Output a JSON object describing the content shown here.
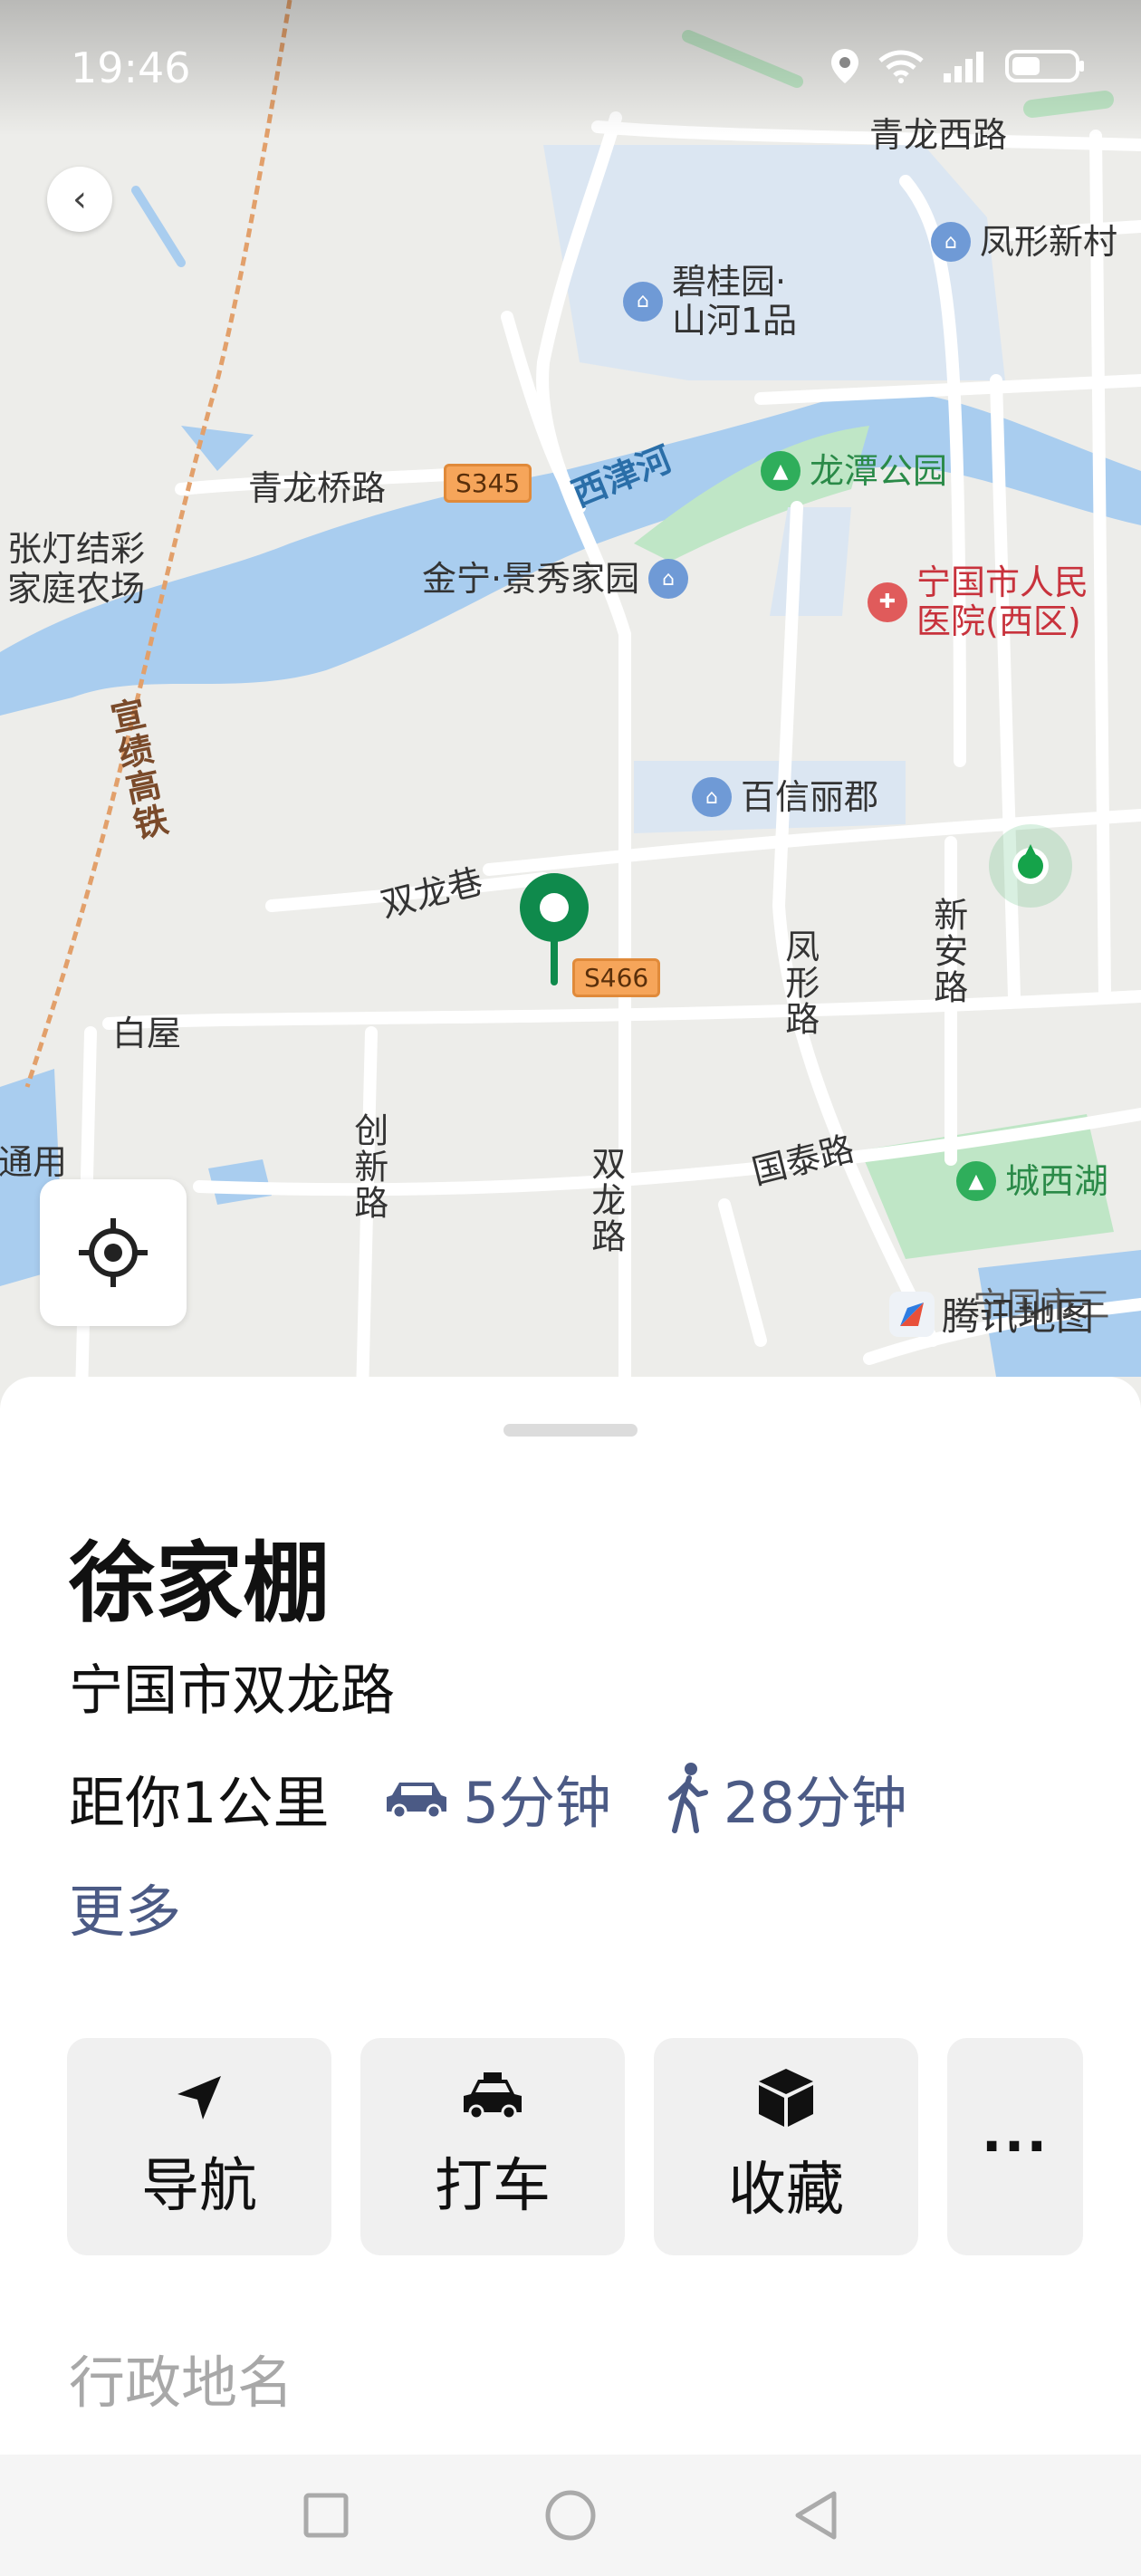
{
  "status_bar": {
    "time": "19:46",
    "icons": [
      "location-icon",
      "wifi-icon",
      "signal-icon",
      "battery-icon"
    ]
  },
  "map": {
    "labels": {
      "qinglong_west_rd": "青龙西路",
      "fengxing_new_village": "凤形新村",
      "bigui_garden": "碧桂园·\n山河1品",
      "qinglong_bridge_rd": "青龙桥路",
      "xijin_river": "西津河",
      "longtan_park": "龙潭公园",
      "zhangdeng_farm": "张灯结彩\n家庭农场",
      "jinning_jingxiu": "金宁·景秀家园",
      "ningguo_hospital": "宁国市人民\n医院(西区)",
      "xuanji_rail": "宣绩高铁",
      "baixin_lijun": "百信丽郡",
      "shuanglong_lane": "双龙巷",
      "fengxing_rd": "凤形路",
      "xinan_rd": "新安路",
      "baiwu": "白屋",
      "chuangxin_rd": "创新路",
      "shuanglong_rd": "双龙路",
      "guotai_rd": "国泰路",
      "chengxi_lake": "城西湖",
      "tongyong_cut": "通用",
      "ningguo_bottom": "宁国市三"
    },
    "shields": {
      "s345": "S345",
      "s466": "S466"
    },
    "tencent_logo": "腾讯地图"
  },
  "place": {
    "name": "徐家棚",
    "address": "宁国市双龙路",
    "distance": "距你1公里",
    "drive_time": "5分钟",
    "walk_time": "28分钟",
    "more_label": "更多"
  },
  "actions": {
    "navigate": "导航",
    "taxi": "打车",
    "favorite": "收藏",
    "more": "···"
  },
  "section": {
    "title": "行政地名"
  },
  "colors": {
    "accent": "#4b5a85",
    "pin": "#0f8a4c",
    "water": "#a9cdef",
    "park": "#bfe6c6"
  }
}
